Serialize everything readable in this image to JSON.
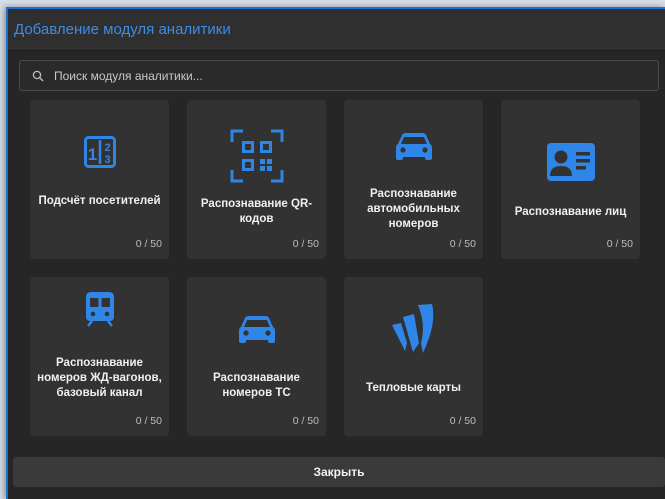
{
  "dialog": {
    "title": "Добавление модуля аналитики"
  },
  "search": {
    "placeholder": "Поиск модуля аналитики..."
  },
  "colors": {
    "accent": "#2f86e8",
    "background": "#262626",
    "card": "#323232"
  },
  "modules": [
    {
      "label": "Подсчёт посетителей",
      "count": "0 / 50",
      "icon": "counter-icon"
    },
    {
      "label": "Распознавание QR-кодов",
      "count": "0 / 50",
      "icon": "qr-code-icon"
    },
    {
      "label": "Распознавание автомобильных номеров",
      "count": "0 / 50",
      "icon": "car-icon"
    },
    {
      "label": "Распознавание лиц",
      "count": "0 / 50",
      "icon": "id-card-icon"
    },
    {
      "label": "Распознавание номеров ЖД-вагонов, базовый канал",
      "count": "0 / 50",
      "icon": "train-icon"
    },
    {
      "label": "Распознавание номеров ТС",
      "count": "0 / 50",
      "icon": "car-icon"
    },
    {
      "label": "Тепловые карты",
      "count": "0 / 50",
      "icon": "heatmap-icon"
    }
  ],
  "footer": {
    "close_label": "Закрыть"
  }
}
